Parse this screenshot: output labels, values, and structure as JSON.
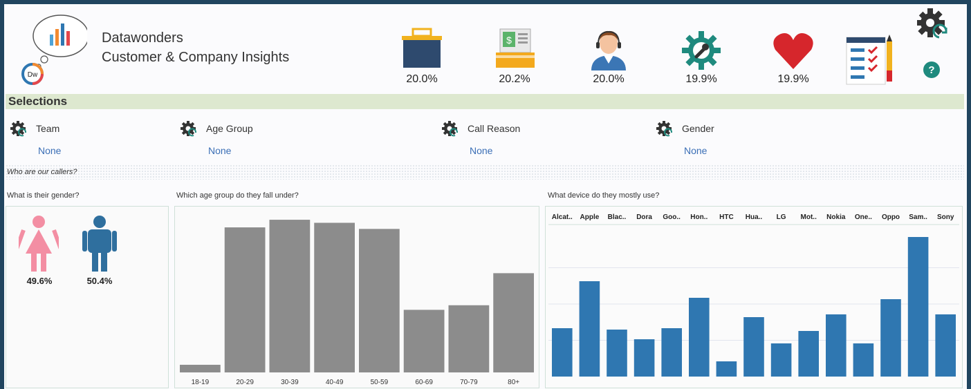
{
  "header": {
    "brand_name": "Datawonders",
    "brand_subtitle": "Customer & Company Insights",
    "logo_badge": "Dw",
    "help_label": "?"
  },
  "kpis": [
    {
      "icon": "basket-icon",
      "value": "20.0%"
    },
    {
      "icon": "cash-register-icon",
      "value": "20.2%"
    },
    {
      "icon": "support-agent-icon",
      "value": "20.0%"
    },
    {
      "icon": "gear-wrench-icon",
      "value": "19.9%"
    },
    {
      "icon": "heart-icon",
      "value": "19.9%"
    }
  ],
  "selections": {
    "title": "Selections",
    "filters": [
      {
        "label": "Team",
        "value": "None"
      },
      {
        "label": "Age Group",
        "value": "None"
      },
      {
        "label": "Call Reason",
        "value": "None"
      },
      {
        "label": "Gender",
        "value": "None"
      }
    ]
  },
  "section_title": "Who are our callers?",
  "gender_panel": {
    "question": "What is their gender?",
    "female_pct": "49.6%",
    "male_pct": "50.4%"
  },
  "age_panel": {
    "question": "Which age group do they fall under?"
  },
  "device_panel": {
    "question": "What device do they mostly use?"
  },
  "colors": {
    "accent_green": "#dde8cf",
    "age_bar": "#8c8c8c",
    "device_bar": "#2f77b1",
    "female": "#f38ea3",
    "male": "#2f6f9e"
  },
  "chart_data": [
    {
      "type": "bar",
      "categories": [
        "18-19",
        "20-29",
        "30-39",
        "40-49",
        "50-59",
        "60-69",
        "70-79",
        "80+"
      ],
      "values": [
        5,
        95,
        100,
        98,
        94,
        41,
        44,
        65
      ],
      "ylim": [
        0,
        105
      ]
    },
    {
      "type": "bar",
      "categories": [
        "Alcat..",
        "Apple",
        "Blac..",
        "Dora",
        "Goo..",
        "Hon..",
        "HTC",
        "Hua..",
        "LG",
        "Mot..",
        "Nokia",
        "One..",
        "Oppo",
        "Sam..",
        "Sony"
      ],
      "values": [
        35,
        69,
        34,
        27,
        35,
        57,
        11,
        43,
        24,
        33,
        45,
        24,
        56,
        101,
        45
      ],
      "ylim": [
        0,
        105
      ]
    }
  ]
}
